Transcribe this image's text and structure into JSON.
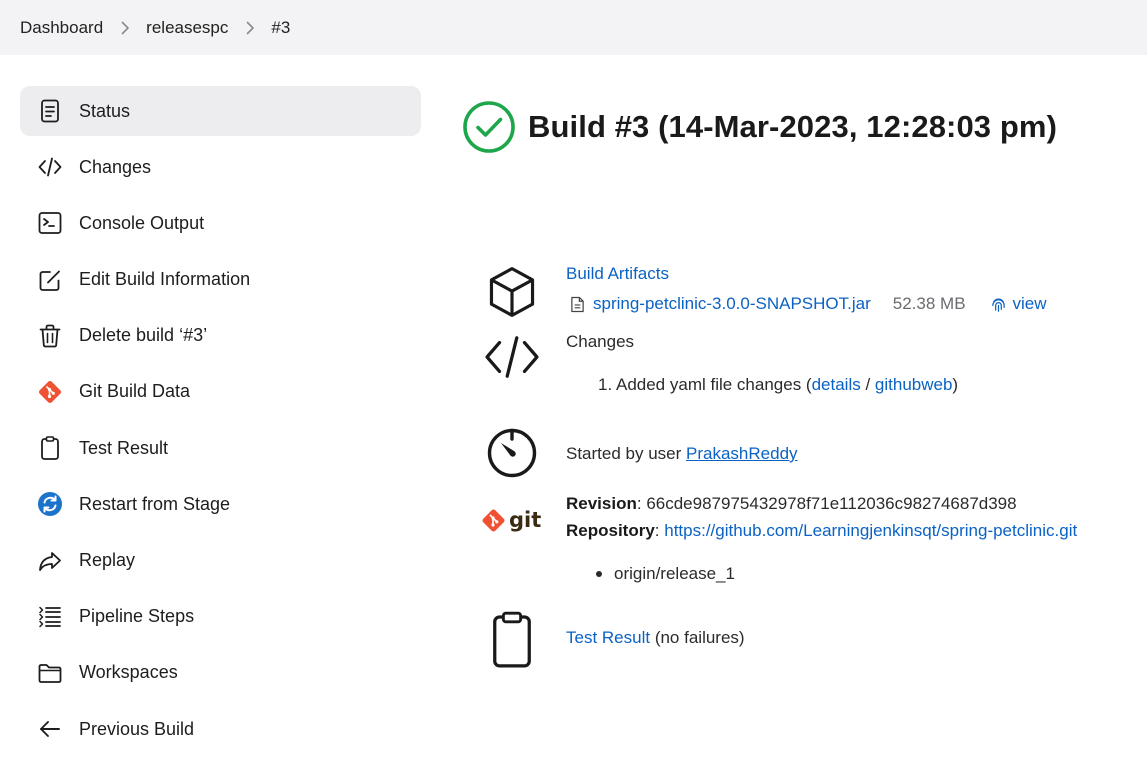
{
  "breadcrumb": {
    "items": [
      "Dashboard",
      "releasespc",
      "#3"
    ]
  },
  "sidebar": {
    "items": [
      {
        "label": "Status",
        "icon": "document-icon"
      },
      {
        "label": "Changes",
        "icon": "code-icon"
      },
      {
        "label": "Console Output",
        "icon": "terminal-icon"
      },
      {
        "label": "Edit Build Information",
        "icon": "edit-icon"
      },
      {
        "label": "Delete build ‘#3’",
        "icon": "trash-icon"
      },
      {
        "label": "Git Build Data",
        "icon": "git-logo-icon"
      },
      {
        "label": "Test Result",
        "icon": "clipboard-icon"
      },
      {
        "label": "Restart from Stage",
        "icon": "restart-icon"
      },
      {
        "label": "Replay",
        "icon": "replay-arrow-icon"
      },
      {
        "label": "Pipeline Steps",
        "icon": "list-steps-icon"
      },
      {
        "label": "Workspaces",
        "icon": "folder-icon"
      },
      {
        "label": "Previous Build",
        "icon": "arrow-left-icon"
      }
    ]
  },
  "main": {
    "title": "Build #3 (14-Mar-2023, 12:28:03 pm)",
    "status_color": "#1ea64b",
    "artifacts": {
      "heading": "Build Artifacts",
      "file_name": "spring-petclinic-3.0.0-SNAPSHOT.jar",
      "file_size": "52.38 MB",
      "view_label": "view"
    },
    "changes": {
      "heading": "Changes",
      "item_number": "1.",
      "item_text": "Added yaml file changes (",
      "details_label": "details",
      "separator": " / ",
      "githubweb_label": "githubweb",
      "close_paren": ")"
    },
    "started": {
      "prefix": "Started by user ",
      "user": "PrakashReddy"
    },
    "git": {
      "revision_label": "Revision",
      "revision_value": "66cde987975432978f71e112036c98274687d398",
      "repository_label": "Repository",
      "repository_url": "https://github.com/Learningjenkinsqt/spring-petclinic.git",
      "branch": "origin/release_1",
      "logo_text": "git",
      "logo_color": "#f05133"
    },
    "tests": {
      "label": "Test Result",
      "suffix": " (no failures)"
    }
  }
}
